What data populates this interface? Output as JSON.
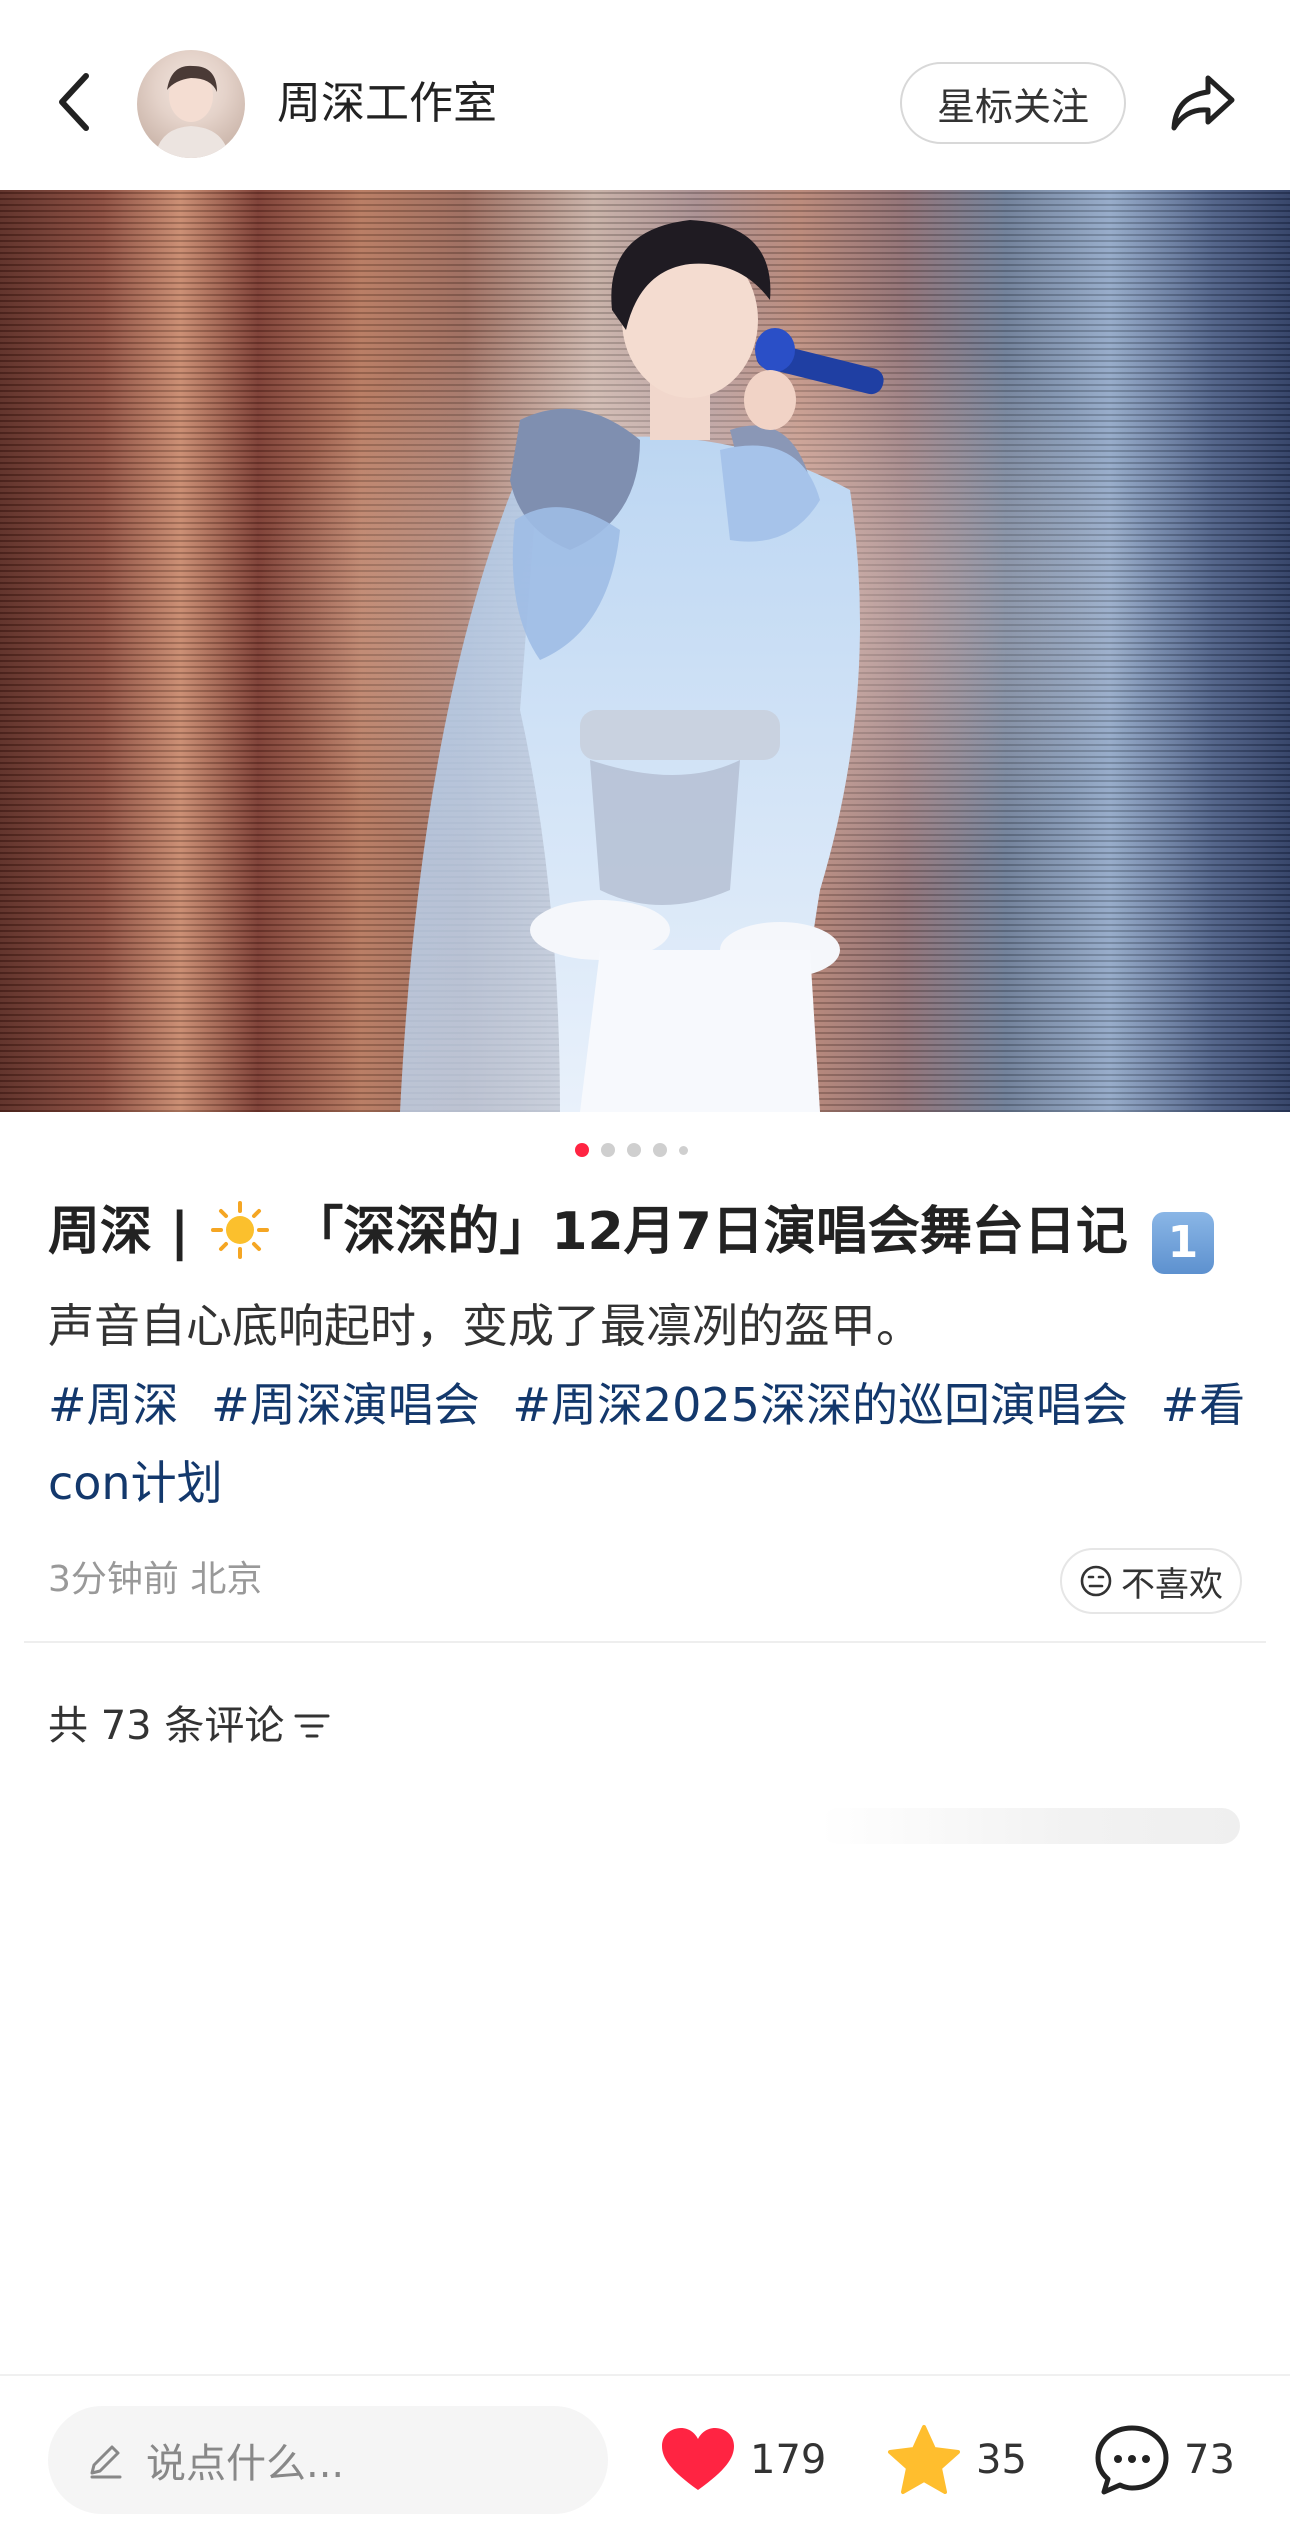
{
  "header": {
    "author_name": "周深工作室",
    "follow_label": "星标关注"
  },
  "carousel": {
    "total": 5,
    "active_index": 0
  },
  "post": {
    "title_prefix": "周深 | ",
    "title_main": "「深深的」12月7日演唱会舞台日记",
    "title_keycap": "1",
    "body": "声音自心底响起时，变成了最凛冽的盔甲。",
    "tags": [
      "#周深",
      "#周深演唱会",
      "#周深2025深深的巡回演唱会",
      "#看con计划"
    ],
    "meta": "3分钟前 北京",
    "dislike_label": "不喜欢"
  },
  "comments": {
    "header_label": "共 73 条评论"
  },
  "bottom_bar": {
    "input_placeholder": "说点什么...",
    "like_count": "179",
    "collect_count": "35",
    "comment_count": "73"
  },
  "colors": {
    "accent": "#ff2442",
    "tag": "#13386c",
    "star": "#ffbe2e"
  },
  "icons": {
    "back": "chevron-left-icon",
    "share": "share-arrow-icon",
    "dislike": "meh-face-icon",
    "sort": "sort-lines-icon",
    "pencil": "pencil-icon",
    "like": "heart-icon",
    "collect": "star-icon",
    "comment": "speech-bubble-icon"
  }
}
